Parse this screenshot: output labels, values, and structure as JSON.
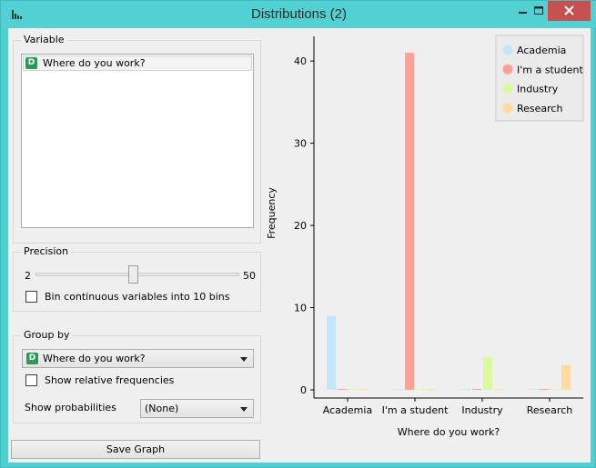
{
  "window": {
    "title": "Distributions (2)"
  },
  "variable_box": {
    "title": "Variable",
    "items": [
      {
        "badge": "D",
        "label": "Where do you work?"
      }
    ]
  },
  "precision_box": {
    "title": "Precision",
    "min_label": "2",
    "max_label": "50",
    "slider_fraction": 0.48,
    "bin_checkbox_label": "Bin continuous variables into 10 bins",
    "bin_checked": false
  },
  "groupby_box": {
    "title": "Group by",
    "badge": "D",
    "selected": "Where do you work?",
    "relative_label": "Show relative frequencies",
    "relative_checked": false,
    "probabilities_label": "Show probabilities",
    "probabilities_selected": "(None)"
  },
  "save_button": "Save Graph",
  "chart_data": {
    "type": "bar",
    "categories": [
      "Academia",
      "I'm a student",
      "Industry",
      "Research"
    ],
    "series": [
      {
        "name": "Academia",
        "color": "#c4e6fa",
        "values": [
          9,
          0,
          0,
          0
        ]
      },
      {
        "name": "I'm a student",
        "color": "#ffa197",
        "values": [
          0,
          41,
          0,
          0
        ]
      },
      {
        "name": "Industry",
        "color": "#dbfa9e",
        "values": [
          0,
          0,
          4,
          0
        ]
      },
      {
        "name": "Research",
        "color": "#ffdc9e",
        "values": [
          0,
          0,
          0,
          3
        ]
      }
    ],
    "xlabel": "Where do you work?",
    "ylabel": "Frequency",
    "yticks": [
      0,
      10,
      20,
      30,
      40
    ],
    "ylim": [
      0,
      43
    ],
    "grid": false,
    "legend_position": "top-right"
  }
}
